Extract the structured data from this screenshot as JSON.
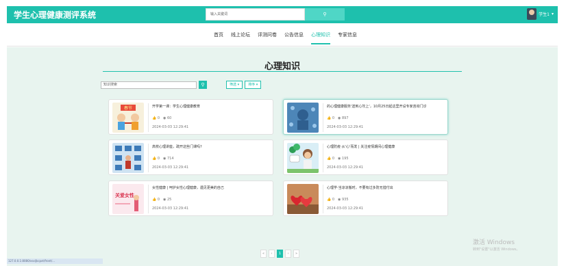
{
  "header": {
    "title": "学生心理健康测评系统",
    "search_placeholder": "输入关键词",
    "search_icon": "search-icon",
    "user_name": "学生1",
    "user_caret": "▾"
  },
  "nav": {
    "items": [
      "首页",
      "线上论坛",
      "评测问卷",
      "公告信息",
      "心理知识",
      "专家信息"
    ],
    "active_index": 4
  },
  "main": {
    "section_title": "心理知识",
    "filter_placeholder": "知识搜索",
    "filter_icon": "search-icon",
    "dropdowns": [
      "筛选 ▾",
      "排序 ▾"
    ]
  },
  "cards": [
    {
      "title": "开学第一课：学生心理健康教育",
      "likes": "0",
      "views": "60",
      "date": "2024-03-03 12:29:41"
    },
    {
      "title": "的心理健康服务'送到心坎上'，10月25日起这里开设专家咨询门诊",
      "likes": "0",
      "views": "897",
      "date": "2024-03-03 12:29:41"
    },
    {
      "title": "高校心理讲座，疏开这些门课吗?",
      "likes": "0",
      "views": "714",
      "date": "2024-03-03 12:29:41"
    },
    {
      "title": "心理防疫·从'心'而发 | 关注疫情期间心理健康",
      "likes": "0",
      "views": "195",
      "date": "2024-03-03 12:29:41"
    },
    {
      "title": "女性健康 | 呵护女性心理健康，遇见更美的自己",
      "likes": "0",
      "views": "25",
      "date": "2024-03-03 12:29:41"
    },
    {
      "title": "心理学·当凉凉搬时，不要有过多防无措付出",
      "likes": "0",
      "views": "935",
      "date": "2024-03-03 12:29:41"
    }
  ],
  "card_icons": {
    "like": "thumbs-up-icon",
    "view": "eye-icon"
  },
  "pagination": {
    "prev2": "«",
    "prev": "‹",
    "current": "1",
    "next": "›",
    "next2": "»"
  },
  "watermark": {
    "line1": "激活 Windows",
    "line2": "转到\"设置\"以激活 Windows。"
  },
  "status_bar": "127.0.0.1:8080/xsxljkcpxt/front/..."
}
